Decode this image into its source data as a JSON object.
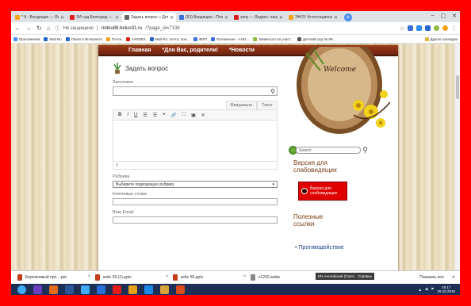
{
  "tabs": [
    {
      "label": "* 8 - Входящие — Янде",
      "color": "#f7a21b"
    },
    {
      "label": "ЗИ сад Белгород — Ян",
      "color": "#e31c1c"
    },
    {
      "label": "Задать вопрос » Детск",
      "color": "#666666",
      "active": true
    },
    {
      "label": "(53) Входящие - Почта",
      "color": "#3b6fd9"
    },
    {
      "label": "запу — Яндекс: нашлось",
      "color": "#e31c1c"
    },
    {
      "label": "ЭНОУ Аттестационные",
      "color": "#f7a21b"
    }
  ],
  "address": {
    "security": "Не защищено",
    "domain": "mdou89.beluo31.ru",
    "path": "/?page_id=7138"
  },
  "bookmarks": [
    {
      "label": "Приложения",
      "color": "#4a8df8"
    },
    {
      "label": "Mail.Ru",
      "color": "#1e66cc"
    },
    {
      "label": "Поиск в Интернете",
      "color": "#1e66cc"
    },
    {
      "label": "Почта",
      "color": "#f7a21b"
    },
    {
      "label": "YANDEX",
      "color": "#e31c1c"
    },
    {
      "label": "Mail.Ru: почта, пои...",
      "color": "#1e66cc"
    },
    {
      "label": "ФИП",
      "color": "#3b6fd9"
    },
    {
      "label": "Положение - АНО...",
      "color": "#3b6fd9"
    },
    {
      "label": "Заявиться на участ...",
      "color": "#8cbf3f"
    },
    {
      "label": "Детский сад № 89...",
      "color": "#555555"
    }
  ],
  "bookmarks_other": "Другие закладки",
  "menu": [
    "Главная",
    "*Для Вас, родители!",
    "*Новости"
  ],
  "form": {
    "title": "Задать вопрос",
    "heading_label": "Заголовок",
    "tab_visual": "Визуально",
    "tab_text": "Текст",
    "toolbar": [
      "B",
      "I",
      "U",
      "☰",
      "☰",
      "❝",
      "🔗",
      "⛶",
      "▣",
      "✕"
    ],
    "path": "p",
    "rubric_label": "Рубрика",
    "rubric_value": "Выберите подходящую рубрику",
    "keywords_label": "Ключевые слова",
    "email_label": "Ваш Email"
  },
  "sidebar": {
    "welcome": "Welcome",
    "search_placeholder": "Search",
    "vision_title_1": "Версия для",
    "vision_title_2": "слабовидящих",
    "vision_btn_1": "Версия для",
    "vision_btn_2": "слабовидящих",
    "useful_1": "Полезные",
    "useful_2": "ссылки",
    "link_1": "• Противодействие"
  },
  "downloads": [
    {
      "label": "Бережливый про....ppt",
      "type": "ppt"
    },
    {
      "label": "кейс 59 (1).pptx",
      "type": "ppt"
    },
    {
      "label": "кейс 59.pptx",
      "type": "ppt"
    },
    {
      "label": "s1200.webp",
      "type": "img"
    }
  ],
  "show_all": "Показать все",
  "lang_popup": "EN Английский (США)",
  "lang_help": "Справка",
  "clock": {
    "time": "15:17",
    "date": "28.10.2019"
  },
  "taskbar_colors": [
    "#3fa9f5",
    "#6a3fbf",
    "#e36d1c",
    "#2b579a",
    "#3fa9f5",
    "#2b6fd9",
    "#e31c1c",
    "#e3a11c",
    "#1e88e5",
    "#d9a33b",
    "#d94c1c"
  ]
}
